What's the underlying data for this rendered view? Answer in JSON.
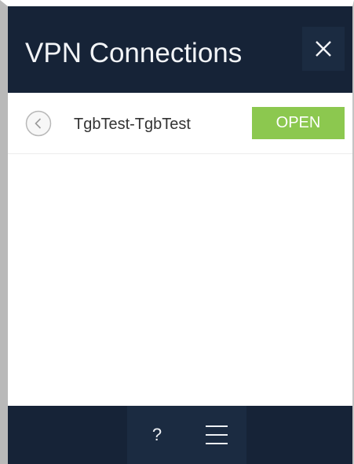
{
  "header": {
    "title": "VPN Connections",
    "close_label": "X"
  },
  "connection": {
    "name": "TgbTest-TgbTest",
    "open_label": "OPEN",
    "back_icon": "chevron-left-icon"
  },
  "footer": {
    "help_label": "?",
    "menu_icon": "hamburger-menu-icon"
  },
  "colors": {
    "header_bg": "#162337",
    "button_bg": "#1b2b41",
    "open_green": "#8cc84f",
    "text_light": "#f2f4f7"
  }
}
